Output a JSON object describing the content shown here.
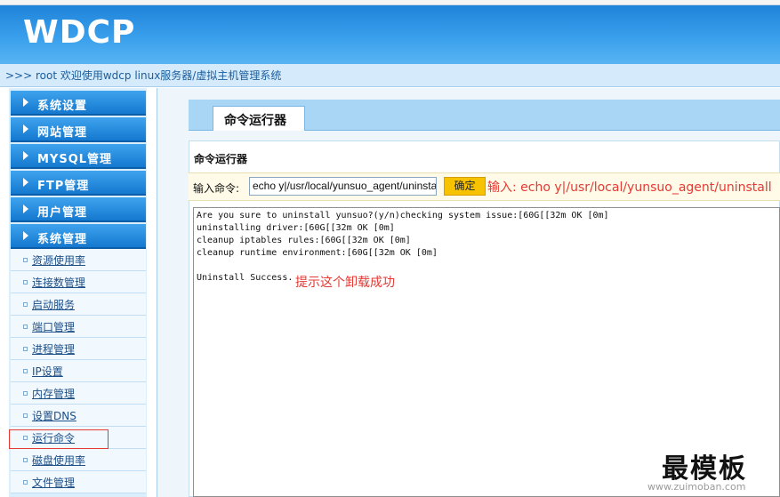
{
  "header": {
    "logo_text": "WDCP"
  },
  "breadcrumb": ">>> root 欢迎使用wdcp linux服务器/虚拟主机管理系统",
  "sidebar": {
    "sections": [
      {
        "label": "系统设置"
      },
      {
        "label": "网站管理"
      },
      {
        "label": "MYSQL管理"
      },
      {
        "label": "FTP管理"
      },
      {
        "label": "用户管理"
      },
      {
        "label": "系统管理"
      }
    ],
    "items": [
      {
        "label": "资源使用率"
      },
      {
        "label": "连接数管理"
      },
      {
        "label": "启动服务"
      },
      {
        "label": "端口管理"
      },
      {
        "label": "进程管理"
      },
      {
        "label": "IP设置"
      },
      {
        "label": "内存管理"
      },
      {
        "label": "设置DNS"
      },
      {
        "label": "运行命令"
      },
      {
        "label": "磁盘使用率"
      },
      {
        "label": "文件管理"
      }
    ]
  },
  "main": {
    "tab_label": "命令运行器",
    "panel_title": "命令运行器",
    "input_label": "输入命令:",
    "input_value": "echo y|/usr/local/yunsuo_agent/uninstall",
    "ok_label": "确定",
    "input_note": "输入: echo y|/usr/local/yunsuo_agent/uninstall",
    "output_lines": [
      "Are you sure to uninstall yunsuo?(y/n)checking system issue:[60G[[32m OK [0m]",
      "uninstalling driver:[60G[[32m OK [0m]",
      "cleanup iptables rules:[60G[[32m OK [0m]",
      "cleanup runtime environment:[60G[[32m OK [0m]",
      "Uninstall Success."
    ],
    "success_note": "提示这个卸载成功"
  },
  "watermark": {
    "text": "最模板",
    "url": "www.zuimoban.com"
  },
  "colors": {
    "accent": "#1479cf",
    "annotation": "#e53935",
    "ok_button": "#f7c200"
  }
}
